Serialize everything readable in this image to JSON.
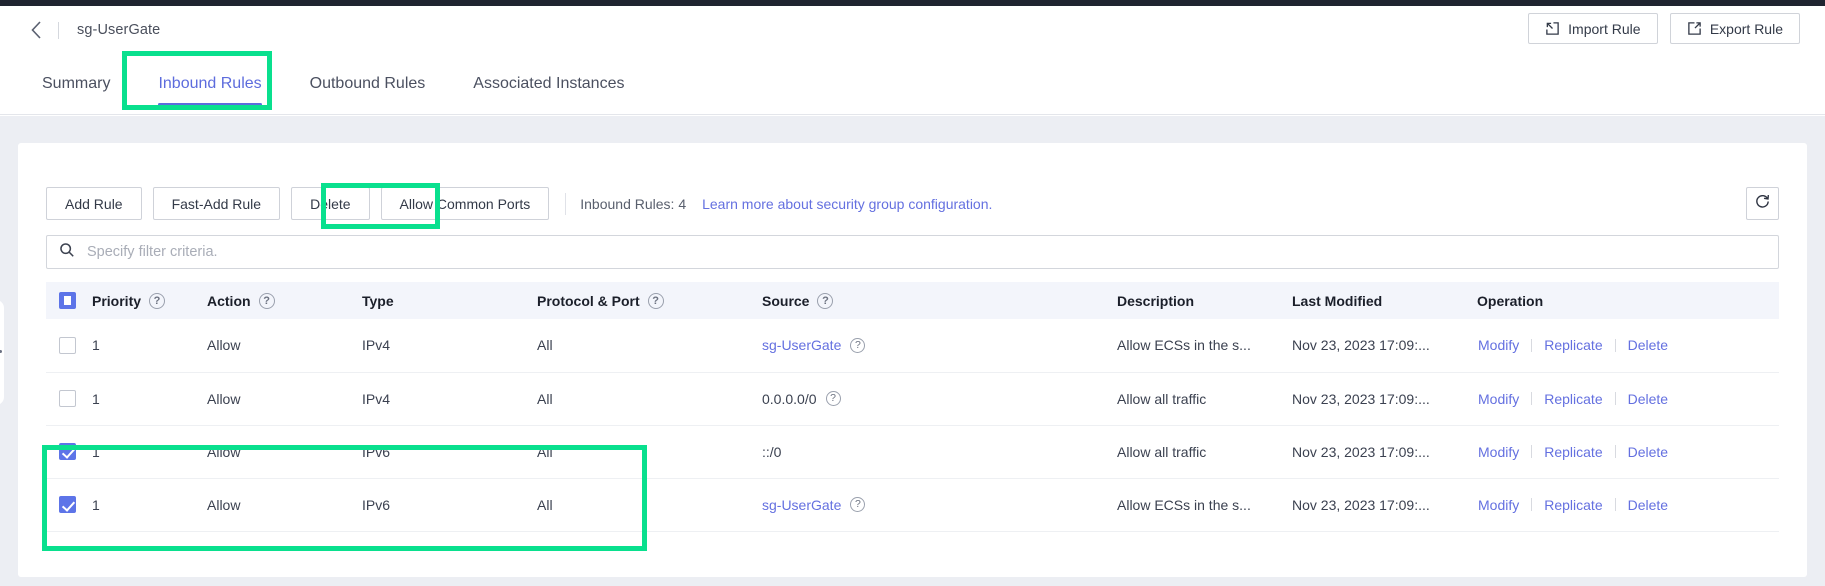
{
  "header": {
    "breadcrumb_title": "sg-UserGate",
    "back_icon": "chevron-left-icon",
    "import_label": "Import Rule",
    "export_label": "Export Rule"
  },
  "tabs": [
    {
      "label": "Summary",
      "active": false
    },
    {
      "label": "Inbound Rules",
      "active": true
    },
    {
      "label": "Outbound Rules",
      "active": false
    },
    {
      "label": "Associated Instances",
      "active": false
    }
  ],
  "toolbar": {
    "add_rule": "Add Rule",
    "fast_add_rule": "Fast-Add Rule",
    "delete": "Delete",
    "allow_common_ports": "Allow Common Ports",
    "count_label": "Inbound Rules: 4",
    "learn_more": "Learn more about security group configuration.",
    "refresh_icon": "refresh-icon"
  },
  "search": {
    "placeholder": "Specify filter criteria.",
    "value": "",
    "icon": "search-icon"
  },
  "table": {
    "columns": [
      {
        "label": "Priority",
        "help": true
      },
      {
        "label": "Action",
        "help": true
      },
      {
        "label": "Type",
        "help": false
      },
      {
        "label": "Protocol & Port",
        "help": true
      },
      {
        "label": "Source",
        "help": true
      },
      {
        "label": "Description",
        "help": false
      },
      {
        "label": "Last Modified",
        "help": false
      },
      {
        "label": "Operation",
        "help": false
      }
    ],
    "header_checkbox_state": "indeterminate",
    "rows": [
      {
        "selected": false,
        "priority": "1",
        "action": "Allow",
        "type": "IPv4",
        "protocol_port": "All",
        "source": "sg-UserGate",
        "source_is_link": true,
        "source_help": true,
        "description": "Allow ECSs in the s...",
        "last_modified": "Nov 23, 2023 17:09:...",
        "operations": [
          "Modify",
          "Replicate",
          "Delete"
        ]
      },
      {
        "selected": false,
        "priority": "1",
        "action": "Allow",
        "type": "IPv4",
        "protocol_port": "All",
        "source": "0.0.0.0/0",
        "source_is_link": false,
        "source_help": true,
        "description": "Allow all traffic",
        "last_modified": "Nov 23, 2023 17:09:...",
        "operations": [
          "Modify",
          "Replicate",
          "Delete"
        ]
      },
      {
        "selected": true,
        "priority": "1",
        "action": "Allow",
        "type": "IPv6",
        "protocol_port": "All",
        "source": "::/0",
        "source_is_link": false,
        "source_help": false,
        "description": "Allow all traffic",
        "last_modified": "Nov 23, 2023 17:09:...",
        "operations": [
          "Modify",
          "Replicate",
          "Delete"
        ]
      },
      {
        "selected": true,
        "priority": "1",
        "action": "Allow",
        "type": "IPv6",
        "protocol_port": "All",
        "source": "sg-UserGate",
        "source_is_link": true,
        "source_help": true,
        "description": "Allow ECSs in the s...",
        "last_modified": "Nov 23, 2023 17:09:...",
        "operations": [
          "Modify",
          "Replicate",
          "Delete"
        ]
      }
    ]
  },
  "colors": {
    "accent": "#5d6cdd",
    "link": "#6470e0",
    "annotation": "#09e08e",
    "header_bg": "#f3f5fb",
    "page_bg": "#eceef3"
  }
}
